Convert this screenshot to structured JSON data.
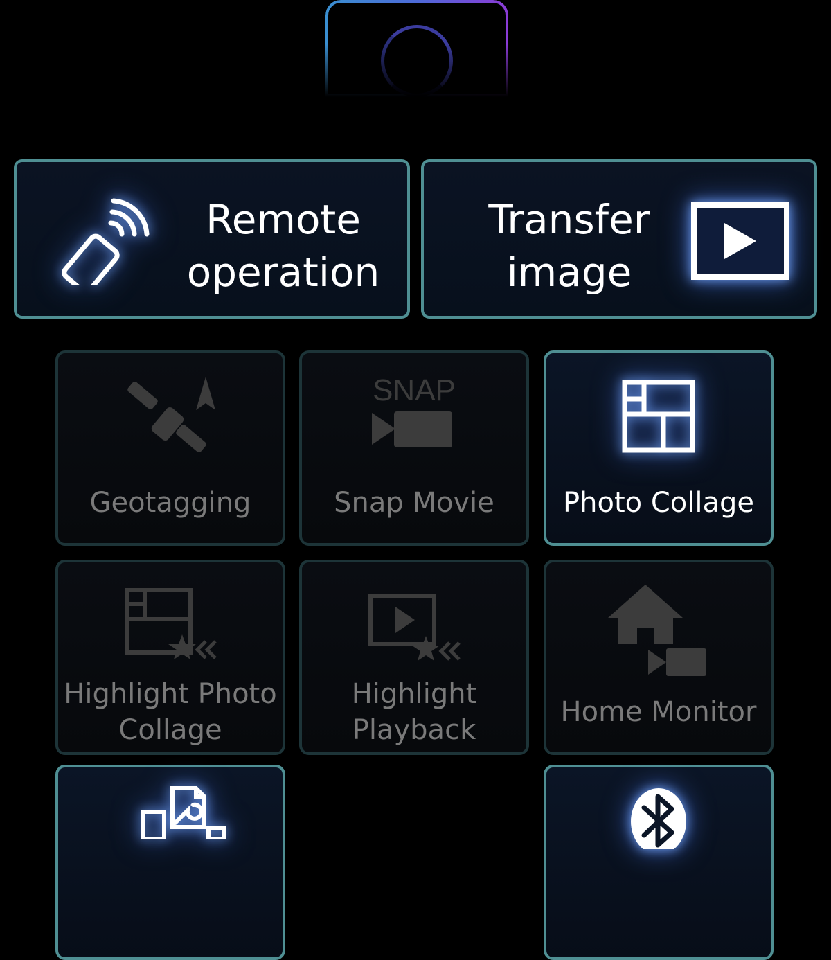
{
  "colors": {
    "tile_border_active": "#4f8f93",
    "tile_border_inactive": "#1d3438",
    "label_active": "#ffffff",
    "label_inactive": "#7a7a7a",
    "connection_ring": "#3b3c9e"
  },
  "connection": {
    "icon": "camera-connection-ring-icon"
  },
  "main_actions": [
    {
      "label": "Remote operation",
      "icon": "remote-control-icon"
    },
    {
      "label": "Transfer image",
      "icon": "play-image-icon"
    }
  ],
  "functions": [
    {
      "label": "Geotagging",
      "icon": "satellite-icon",
      "enabled": false
    },
    {
      "label": "Snap Movie",
      "icon": "snap-movie-icon",
      "icon_text": "SNAP",
      "enabled": false
    },
    {
      "label": "Photo Collage",
      "icon": "collage-icon",
      "enabled": true
    },
    {
      "label": "Highlight Photo Collage",
      "icon": "highlight-collage-icon",
      "enabled": false
    },
    {
      "label": "Highlight Playback",
      "icon": "highlight-playback-icon",
      "enabled": false
    },
    {
      "label": "Home Monitor",
      "icon": "home-monitor-icon",
      "enabled": false
    },
    {
      "label": "",
      "icon": "settings-document-icon",
      "enabled": true
    },
    {
      "label": "",
      "icon": "bluetooth-icon",
      "enabled": true
    }
  ]
}
